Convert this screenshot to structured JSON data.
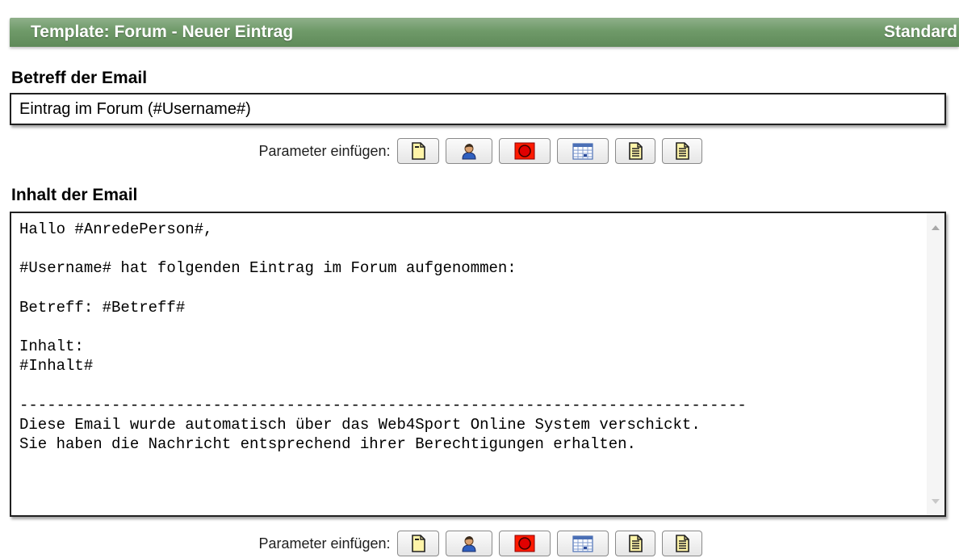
{
  "header": {
    "title": "Template: Forum - Neuer Eintrag",
    "right_label": "Standard"
  },
  "subject": {
    "label": "Betreff der Email",
    "value": "Eintrag im Forum (#Username#)"
  },
  "content": {
    "label": "Inhalt der Email",
    "value": "Hallo #AnredePerson#,\n\n#Username# hat folgenden Eintrag im Forum aufgenommen:\n\nBetreff: #Betreff#\n\nInhalt:\n#Inhalt#\n\n-------------------------------------------------------------------------------\nDiese Email wurde automatisch über das Web4Sport Online System verschickt.\nSie haben die Nachricht entsprechend ihrer Berechtigungen erhalten."
  },
  "parameter_toolbar": {
    "label": "Parameter einfügen:",
    "buttons": [
      {
        "icon": "document-icon"
      },
      {
        "icon": "person-icon"
      },
      {
        "icon": "red-circle-icon"
      },
      {
        "icon": "calendar-icon"
      },
      {
        "icon": "text-document-icon"
      },
      {
        "icon": "text-document-icon"
      }
    ]
  },
  "colors": {
    "header_green": "#6f9a69",
    "header_text": "#ffffff"
  }
}
